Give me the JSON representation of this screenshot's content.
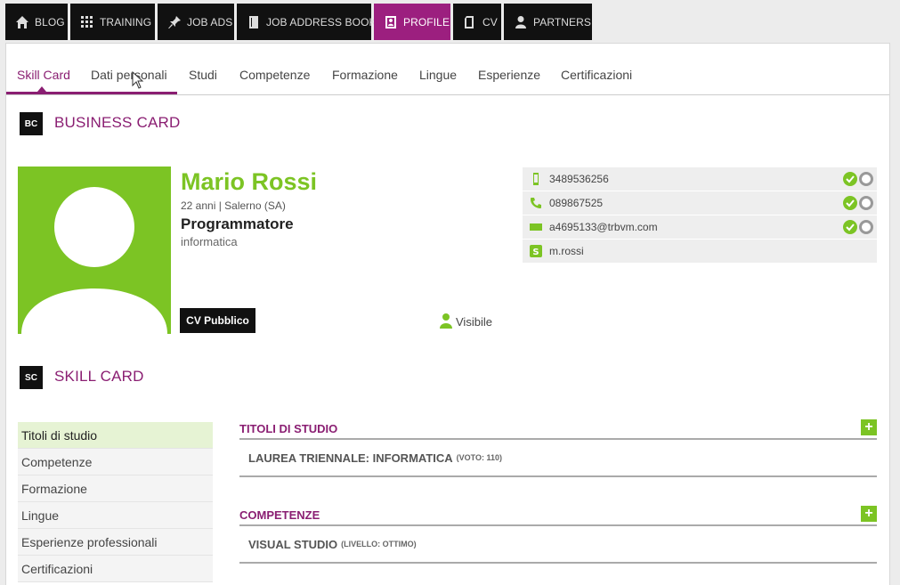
{
  "topnav": [
    {
      "key": "blog",
      "label": "BLOG",
      "icon": "home-icon"
    },
    {
      "key": "training",
      "label": "TRAINING",
      "icon": "grid-icon"
    },
    {
      "key": "jobads",
      "label": "JOB ADS",
      "icon": "pin-icon"
    },
    {
      "key": "addressbook",
      "label": "JOB ADDRESS BOOK",
      "icon": "book-icon"
    },
    {
      "key": "profile",
      "label": "PROFILE",
      "icon": "profile-icon",
      "active": true
    },
    {
      "key": "cv",
      "label": "CV",
      "icon": "document-icon"
    },
    {
      "key": "partners",
      "label": "PARTNERS",
      "icon": "person-icon"
    }
  ],
  "tabs": [
    "Skill Card",
    "Dati personali",
    "Studi",
    "Competenze",
    "Formazione",
    "Lingue",
    "Esperienze",
    "Certificazioni"
  ],
  "business_card": {
    "badge": "BC",
    "title": "BUSINESS CARD",
    "name": "Mario Rossi",
    "subinfo": "22 anni | Salerno (SA)",
    "job": "Programmatore",
    "field": "informatica",
    "cv_button": "CV Pubblico",
    "visibility": "Visibile"
  },
  "contacts": [
    {
      "icon": "mobile-icon",
      "value": "3489536256",
      "verified": true
    },
    {
      "icon": "phone-icon",
      "value": "089867525",
      "verified": true
    },
    {
      "icon": "email-icon",
      "value": "a4695133@trbvm.com",
      "verified": true
    },
    {
      "icon": "skype-icon",
      "value": "m.rossi",
      "verified": false
    }
  ],
  "skill_card": {
    "badge": "SC",
    "title": "SKILL CARD",
    "menu": [
      "Titoli di studio",
      "Competenze",
      "Formazione",
      "Lingue",
      "Esperienze professionali",
      "Certificazioni"
    ],
    "sections": [
      {
        "title": "TITOLI DI STUDIO",
        "entry": "LAUREA TRIENNALE: INFORMATICA",
        "note": "(VOTO: 110)"
      },
      {
        "title": "COMPETENZE",
        "entry": "VISUAL STUDIO",
        "note": "(LIVELLO: OTTIMO)"
      }
    ]
  },
  "colors": {
    "accent_purple": "#8a1e72",
    "nav_active": "#9c1f7f",
    "accent_green": "#7cc424"
  }
}
